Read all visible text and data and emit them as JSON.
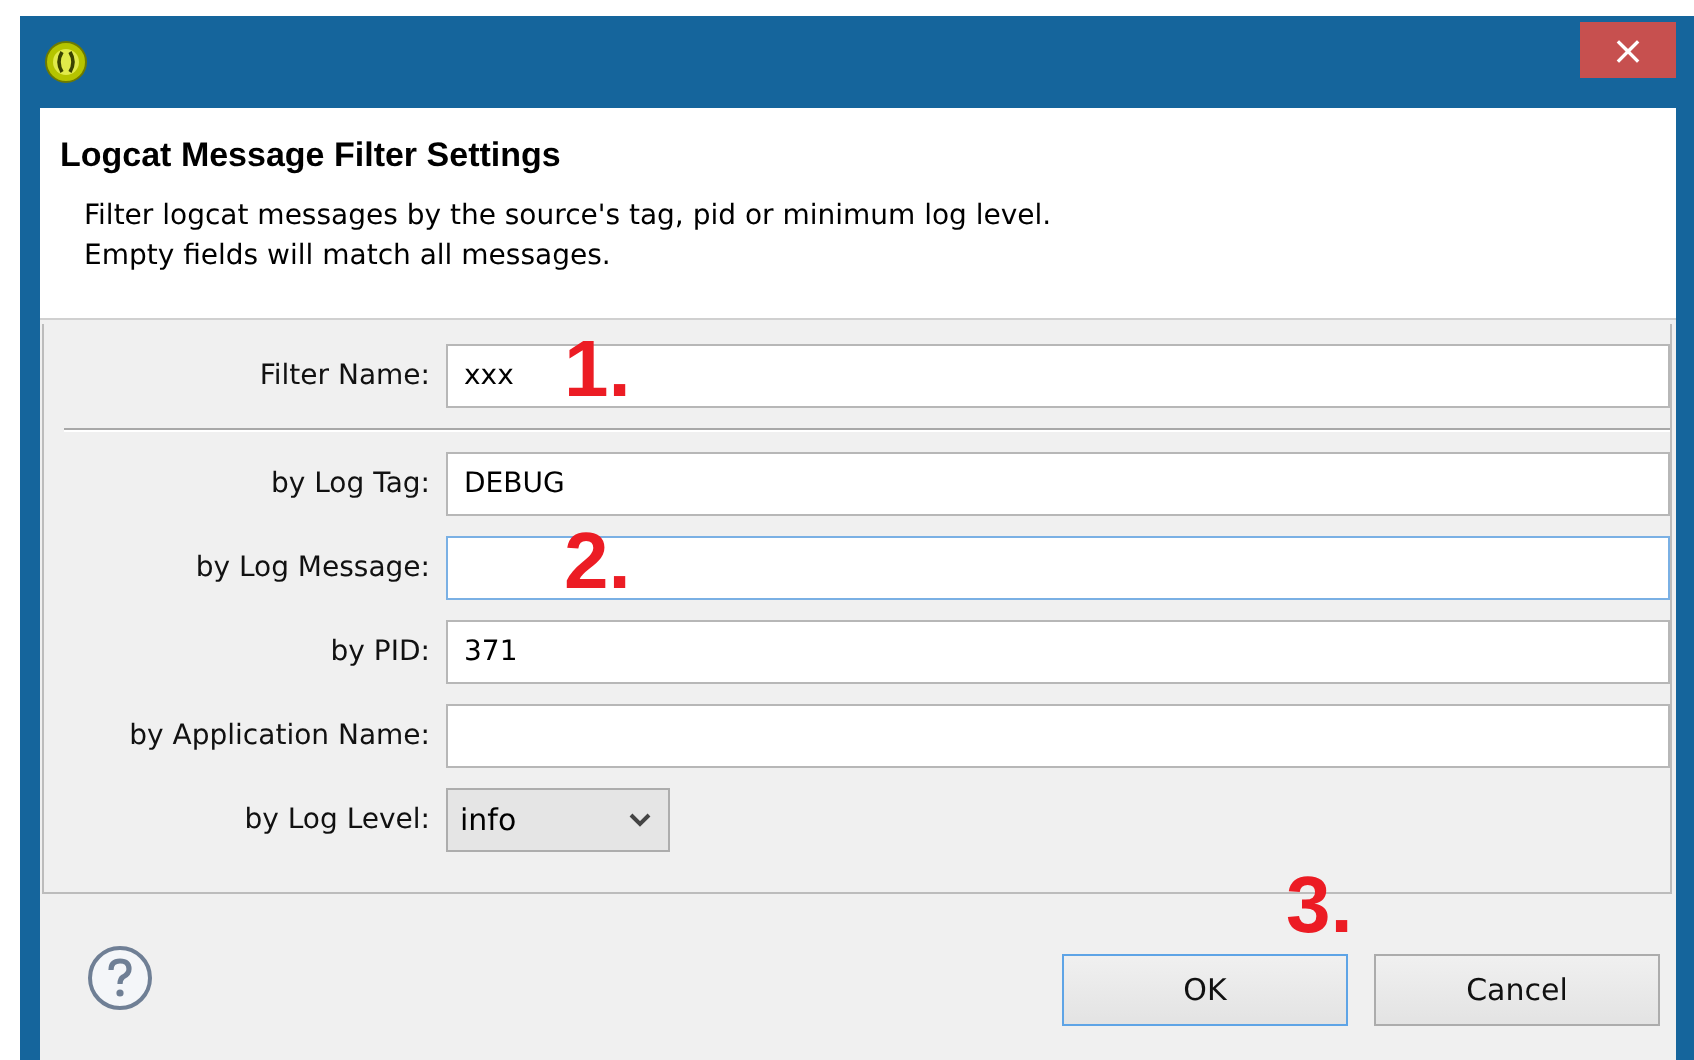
{
  "window": {
    "close": "×"
  },
  "header": {
    "title": "Logcat Message Filter Settings",
    "description": [
      "Filter logcat messages by the source's tag, pid or minimum log level.",
      "Empty fields will match all messages."
    ]
  },
  "fields": [
    {
      "kind": "text",
      "label": "Filter Name:",
      "value": "xxx",
      "focused": false,
      "annotation": "1."
    },
    {
      "kind": "separator"
    },
    {
      "kind": "text",
      "label": "by Log Tag:",
      "value": "DEBUG",
      "focused": false
    },
    {
      "kind": "text",
      "label": "by Log Message:",
      "focused": true,
      "annotation": "2."
    },
    {
      "kind": "text",
      "label": "by PID:",
      "value": "371",
      "focused": false
    },
    {
      "kind": "text",
      "label": "by Application Name:",
      "focused": false
    },
    {
      "kind": "select",
      "label": "by Log Level:",
      "value": "info",
      "focused": false
    }
  ],
  "buttons_annotation": "3.",
  "buttons": [
    {
      "label": "OK",
      "default": true
    },
    {
      "label": "Cancel",
      "default": false
    }
  ]
}
